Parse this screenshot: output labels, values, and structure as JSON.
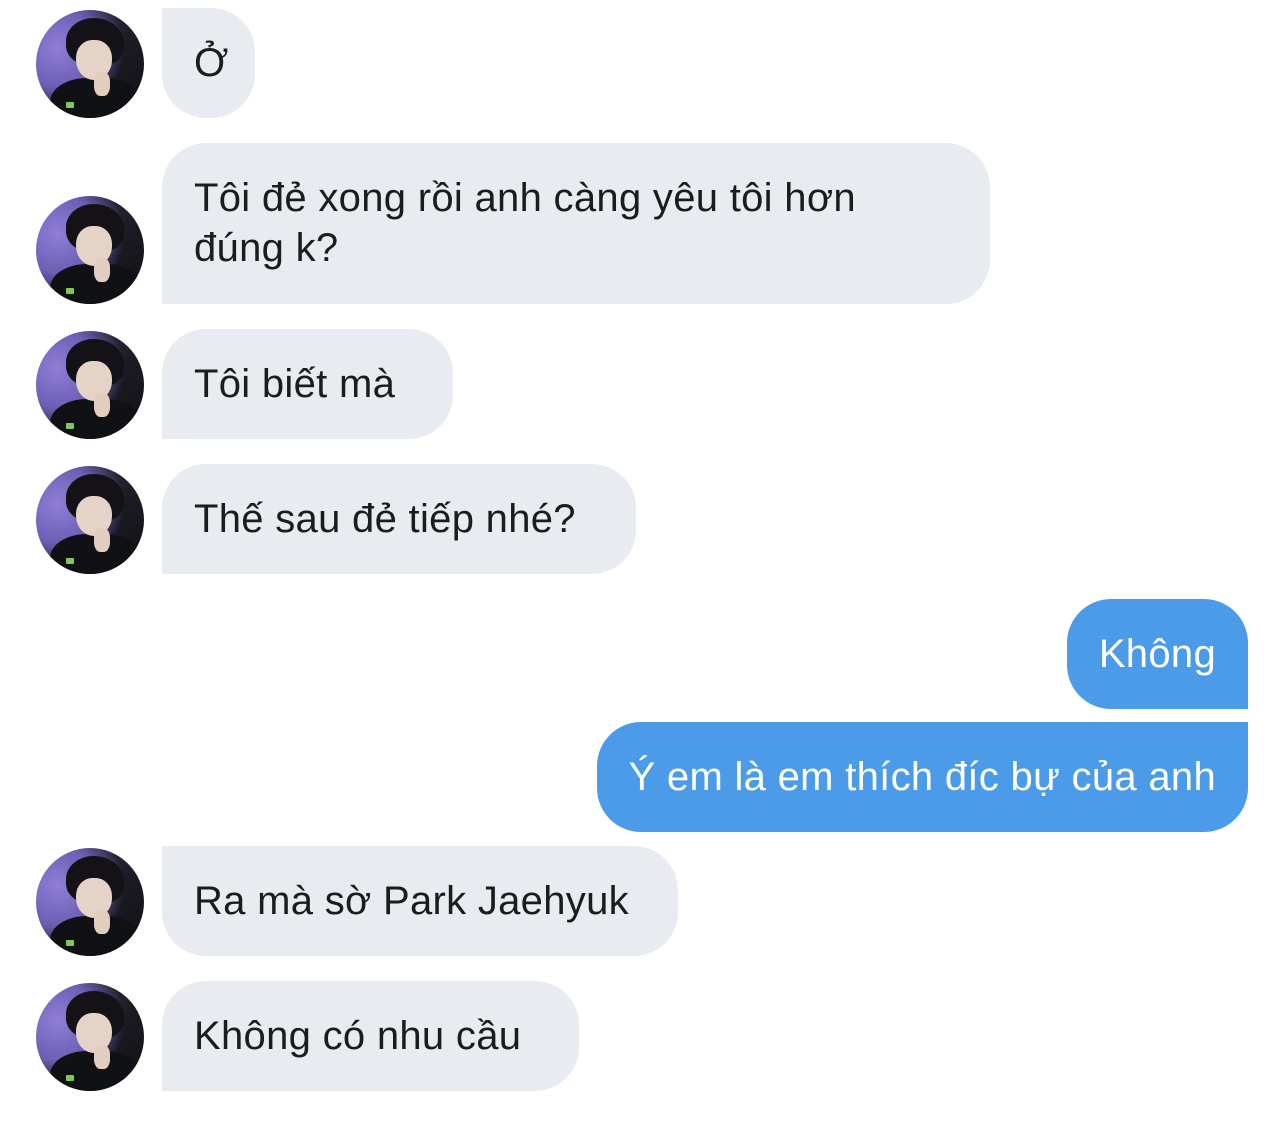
{
  "conversation": {
    "messages": [
      {
        "sender": "them",
        "text": "Ở"
      },
      {
        "sender": "them",
        "text": "Tôi đẻ xong rồi anh càng yêu tôi hơn\nđúng k?"
      },
      {
        "sender": "them",
        "text": "Tôi biết mà"
      },
      {
        "sender": "them",
        "text": "Thế sau đẻ tiếp nhé?"
      },
      {
        "sender": "me",
        "text": "Không"
      },
      {
        "sender": "me",
        "text": "Ý em là em thích đíc bự của anh"
      },
      {
        "sender": "them",
        "text": "Ra mà sờ Park Jaehyuk"
      },
      {
        "sender": "them",
        "text": "Không có nhu cầu"
      }
    ]
  },
  "colors": {
    "incoming_bubble": "#e8ecf0",
    "outgoing_bubble": "#4b9be8",
    "incoming_text": "#1c1c1e",
    "outgoing_text": "#ffffff",
    "background": "#ffffff"
  },
  "icons": {
    "avatar": "contact-avatar-photo"
  }
}
